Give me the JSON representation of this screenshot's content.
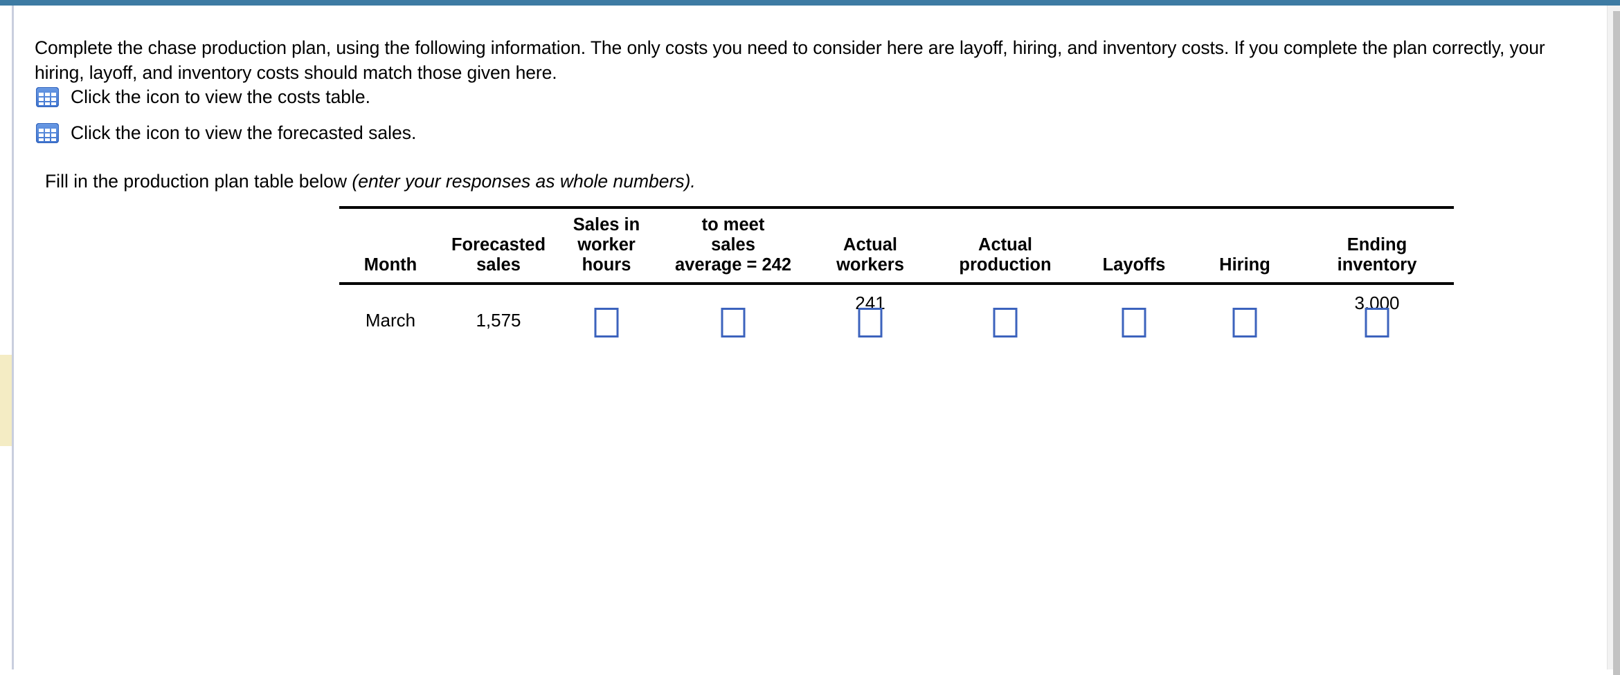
{
  "chrome": {
    "accent_color": "#3d7ba3",
    "highlight_strip_color": "#f4ecc4",
    "scrollbar_color": "#c2c2c2",
    "input_border_color": "#3c63bd",
    "icon_color": "#4b82d8"
  },
  "intro": {
    "paragraph": "Complete the chase production plan, using the following information. The only costs you need to consider here are layoff, hiring, and inventory costs. If you complete the plan correctly, your hiring, layoff, and inventory costs should match those given here."
  },
  "links": [
    {
      "id": "costs-table",
      "icon": "table-grid-icon",
      "label": "Click the icon to view the costs table."
    },
    {
      "id": "forecasted-sales",
      "icon": "table-grid-icon",
      "label": "Click the icon to view the forecasted sales."
    }
  ],
  "fill_instruction": {
    "lead": "Fill in the production plan table below ",
    "italic": "(enter your responses as whole numbers)."
  },
  "table": {
    "headers": [
      "Month",
      "Forecasted\nsales",
      "Sales in\nworker\nhours",
      "to meet\nsales\naverage = 242",
      "Actual\nworkers",
      "Actual\nproduction",
      "Layoffs",
      "Hiring",
      "Ending\ninventory"
    ],
    "rows": [
      {
        "month": "March",
        "forecasted_sales": "1,575",
        "sales_in_worker_hours": {
          "type": "input",
          "value": ""
        },
        "to_meet_sales": {
          "type": "input",
          "value": ""
        },
        "actual_workers": {
          "type": "input",
          "value": "",
          "prefill": "241"
        },
        "actual_production": {
          "type": "input",
          "value": ""
        },
        "layoffs": {
          "type": "input",
          "value": ""
        },
        "hiring": {
          "type": "input",
          "value": ""
        },
        "ending_inventory": {
          "type": "input",
          "value": "",
          "prefill": "3,000"
        }
      }
    ]
  }
}
